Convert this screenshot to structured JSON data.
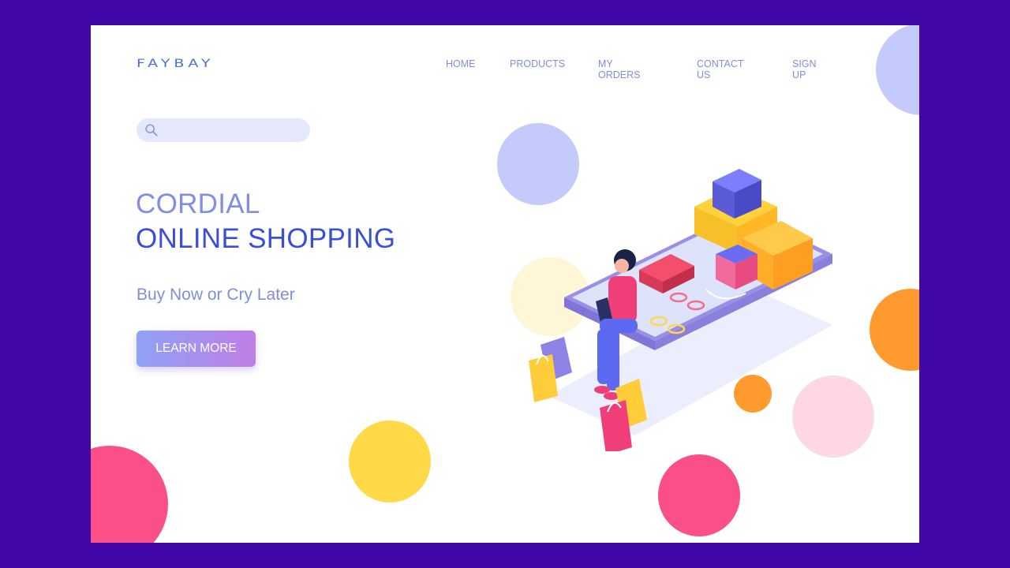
{
  "brand": {
    "logo": "FAYBAY"
  },
  "nav": {
    "items": [
      "HOME",
      "PRODUCTS",
      "MY ORDERS",
      "CONTACT US",
      "SIGN UP"
    ]
  },
  "search": {
    "placeholder": "",
    "icon": "search-icon"
  },
  "hero": {
    "title_line1": "CORDIAL",
    "title_line2": "ONLINE SHOPPING",
    "tagline": "Buy Now or Cry Later",
    "cta": "LEARN MORE"
  },
  "colors": {
    "frame": "#4207a8",
    "page": "#ffffff",
    "primary": "#3a4fd6",
    "light_primary": "#7f8fe6",
    "cta_start": "#8fa2f5",
    "cta_end": "#c07ee6",
    "pink": "#fb5087",
    "yellow": "#ffd947",
    "orange": "#ff9b2e",
    "lavender": "#c4caf9",
    "light_pink": "#ffd6e4"
  }
}
